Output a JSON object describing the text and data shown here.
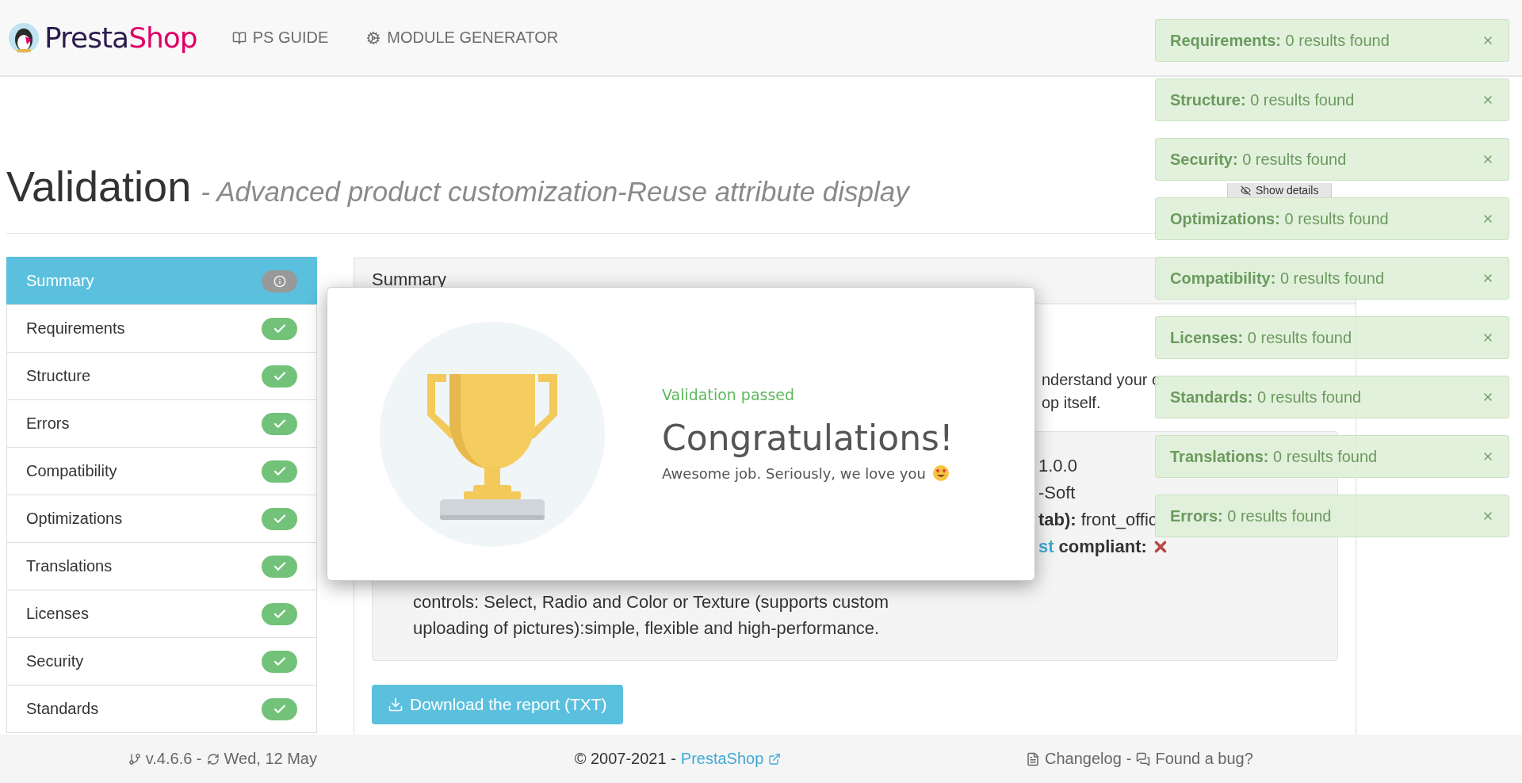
{
  "header": {
    "logo": {
      "first": "Presta",
      "second": "Shop"
    },
    "nav": [
      {
        "kind": "guide",
        "label": "PS GUIDE"
      },
      {
        "kind": "generator",
        "label": "MODULE GENERATOR"
      }
    ]
  },
  "page_title": {
    "title": "Validation",
    "subtitle": "- Advanced product customization-Reuse attribute display"
  },
  "sidebar": {
    "items": [
      {
        "label": "Summary",
        "kind": "info",
        "selected": true
      },
      {
        "label": "Requirements",
        "kind": "check",
        "selected": false
      },
      {
        "label": "Structure",
        "kind": "check",
        "selected": false
      },
      {
        "label": "Errors",
        "kind": "check",
        "selected": false
      },
      {
        "label": "Compatibility",
        "kind": "check",
        "selected": false
      },
      {
        "label": "Optimizations",
        "kind": "check",
        "selected": false
      },
      {
        "label": "Translations",
        "kind": "check",
        "selected": false
      },
      {
        "label": "Licenses",
        "kind": "check",
        "selected": false
      },
      {
        "label": "Security",
        "kind": "check",
        "selected": false
      },
      {
        "label": "Standards",
        "kind": "check",
        "selected": false
      }
    ]
  },
  "panel": {
    "title": "Summary",
    "intro_fragments": [
      "nderstand your c",
      "op itself."
    ],
    "details": [
      {
        "kind": "plain",
        "text": "1.0.0"
      },
      {
        "kind": "plain",
        "text": "-Soft"
      },
      {
        "kind": "labeled",
        "label": "tab):",
        "text": "front_offic"
      },
      {
        "kind": "compliance",
        "link": "st",
        "label": "compliant:",
        "compliant": false
      }
    ],
    "description": "controls: Select, Radio and Color or Texture (supports custom uploading of pictures):simple, flexible and high-performance.",
    "download_button": "Download the report (TXT)",
    "show_details_button": "Show details"
  },
  "modal": {
    "status": "Validation passed",
    "heading": "Congratulations!",
    "message": "Awesome job. Seriously, we love you"
  },
  "notifications": [
    {
      "title": "Requirements:",
      "message": "0 results found"
    },
    {
      "title": "Structure:",
      "message": "0 results found"
    },
    {
      "title": "Security:",
      "message": "0 results found"
    },
    {
      "title": "Optimizations:",
      "message": "0 results found"
    },
    {
      "title": "Compatibility:",
      "message": "0 results found"
    },
    {
      "title": "Licenses:",
      "message": "0 results found"
    },
    {
      "title": "Standards:",
      "message": "0 results found"
    },
    {
      "title": "Translations:",
      "message": "0 results found"
    },
    {
      "title": "Errors:",
      "message": "0 results found"
    }
  ],
  "footer": {
    "version": "v.4.6.6 -",
    "date": "Wed, 12 May",
    "copyright": "© 2007-2021 -",
    "brand_link": "PrestaShop",
    "changelog": "Changelog",
    "separator": "-",
    "bug_link": "Found a bug?"
  }
}
